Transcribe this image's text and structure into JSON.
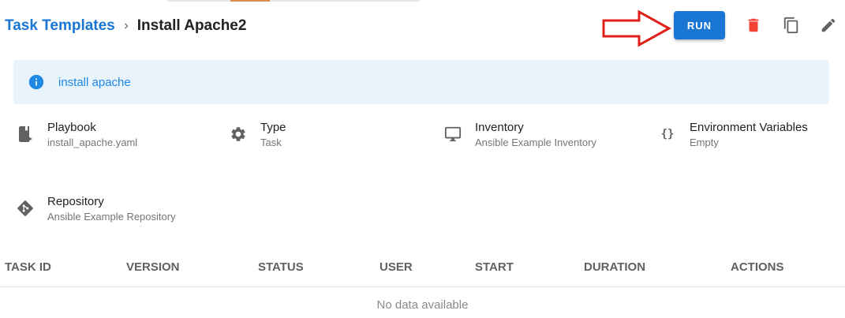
{
  "breadcrumb": {
    "parent": "Task Templates",
    "current": "Install Apache2"
  },
  "toolbar": {
    "run_label": "RUN",
    "delete_icon": "trash-icon",
    "copy_icon": "copy-icon",
    "edit_icon": "pencil-icon"
  },
  "alert": {
    "text": "install apache"
  },
  "details": {
    "playbook": {
      "label": "Playbook",
      "value": "install_apache.yaml"
    },
    "type": {
      "label": "Type",
      "value": "Task"
    },
    "inventory": {
      "label": "Inventory",
      "value": "Ansible Example Inventory"
    },
    "environment": {
      "label": "Environment Variables",
      "value": "Empty",
      "icon_text": "{}"
    },
    "repository": {
      "label": "Repository",
      "value": "Ansible Example Repository"
    }
  },
  "table": {
    "columns": [
      "TASK ID",
      "VERSION",
      "STATUS",
      "USER",
      "START",
      "DURATION",
      "ACTIONS"
    ],
    "empty_text": "No data available"
  },
  "colors": {
    "primary": "#1976d2",
    "danger": "#f44336",
    "annotation_arrow": "#e0201b",
    "alert_bg": "#e8f3fc"
  }
}
